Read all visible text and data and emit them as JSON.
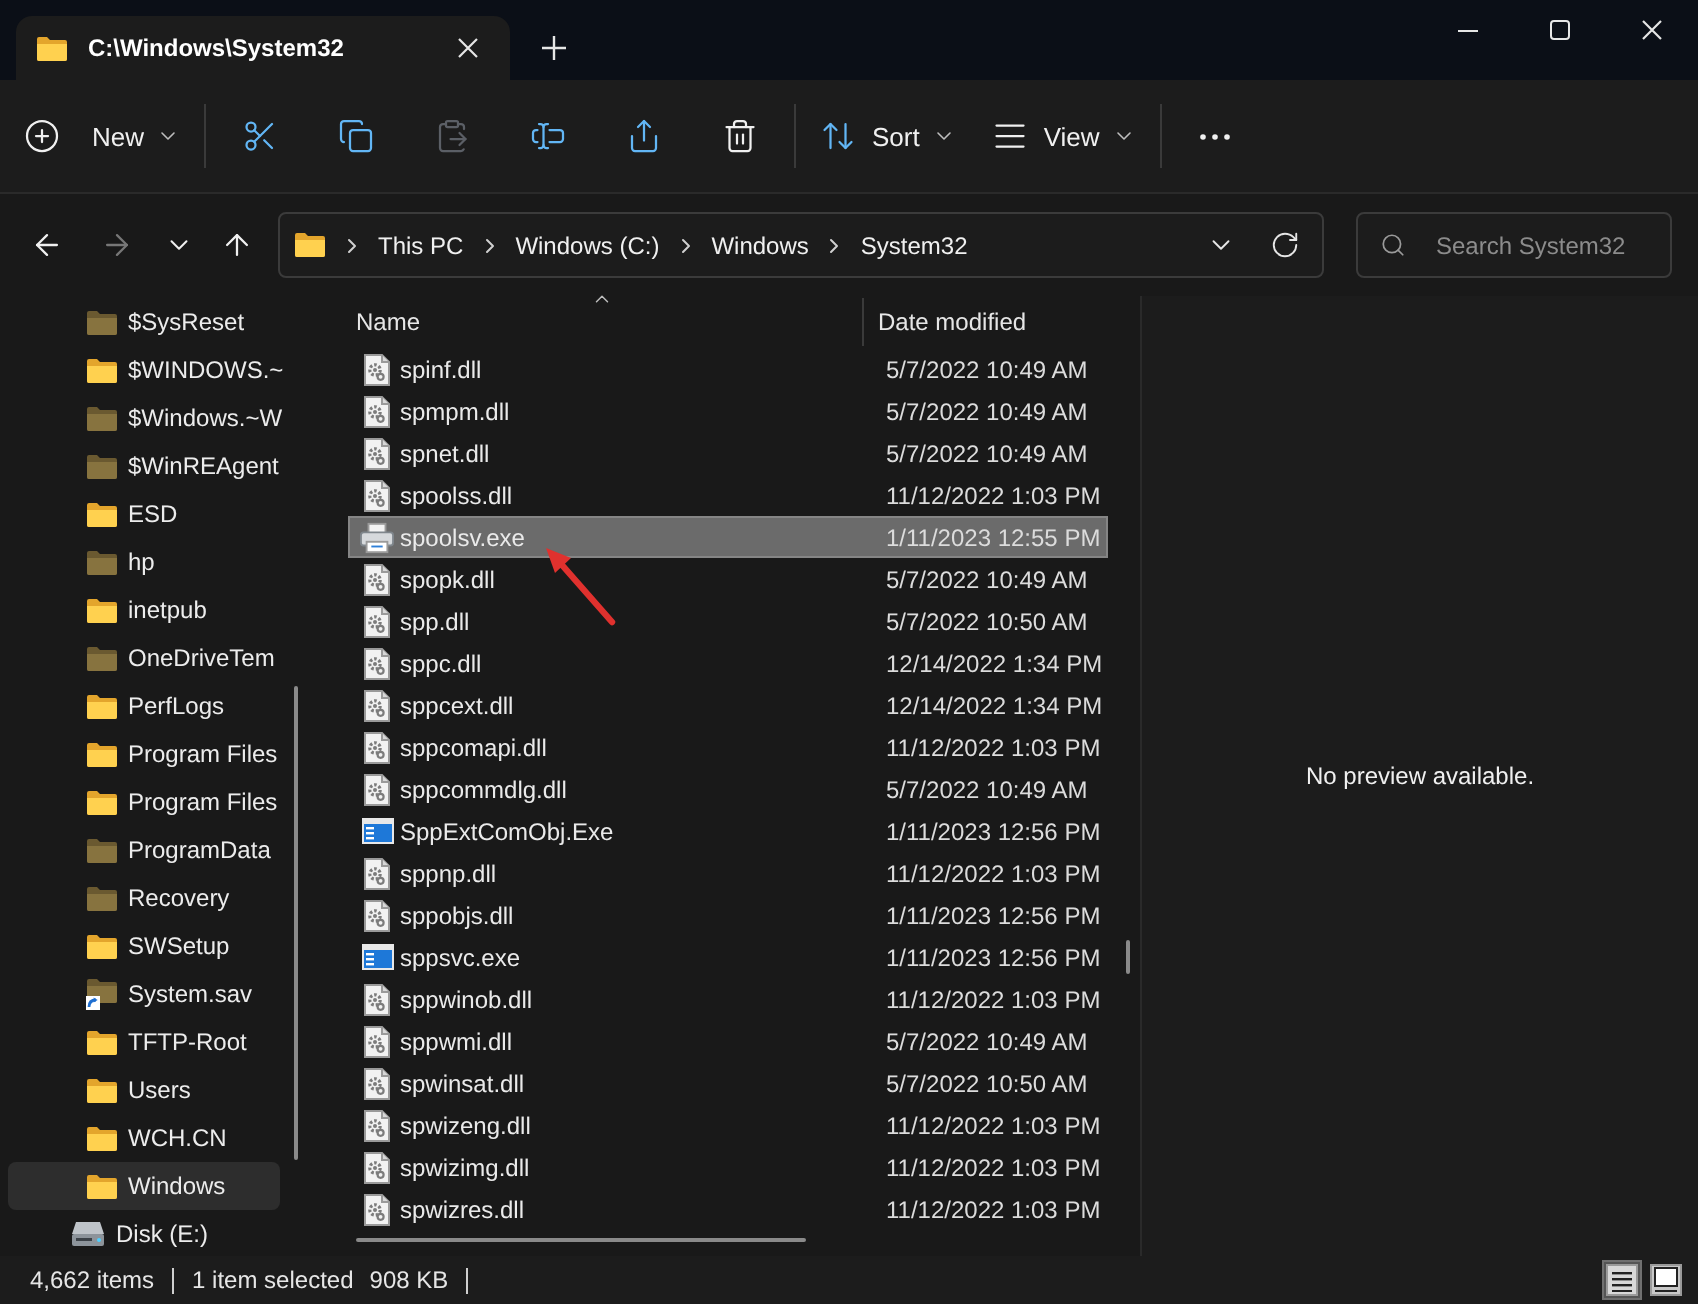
{
  "window": {
    "tab_title": "C:\\Windows\\System32"
  },
  "toolbar": [
    {
      "kind": "new",
      "label": "New",
      "disabled": false
    },
    {
      "kind": "cut",
      "disabled": false
    },
    {
      "kind": "copy",
      "disabled": false
    },
    {
      "kind": "paste",
      "disabled": true
    },
    {
      "kind": "rename",
      "disabled": false
    },
    {
      "kind": "share",
      "disabled": false
    },
    {
      "kind": "delete",
      "disabled": false
    },
    {
      "kind": "sort",
      "label": "Sort",
      "disabled": false
    },
    {
      "kind": "view",
      "label": "View",
      "disabled": false
    },
    {
      "kind": "more",
      "disabled": false
    }
  ],
  "navigation": [
    {
      "kind": "back",
      "disabled": false
    },
    {
      "kind": "forward",
      "disabled": true
    },
    {
      "kind": "recent",
      "disabled": false
    },
    {
      "kind": "up",
      "disabled": false
    }
  ],
  "address_bar": {
    "crumbs": [
      "This PC",
      "Windows (C:)",
      "Windows",
      "System32"
    ]
  },
  "search": {
    "placeholder": "Search System32"
  },
  "sidebar": {
    "items": [
      {
        "kind": "folder",
        "label": "$SysReset",
        "dimmed": true,
        "selected": false
      },
      {
        "kind": "folder",
        "label": "$WINDOWS.~",
        "dimmed": false,
        "selected": false
      },
      {
        "kind": "folder",
        "label": "$Windows.~W",
        "dimmed": true,
        "selected": false
      },
      {
        "kind": "folder",
        "label": "$WinREAgent",
        "dimmed": true,
        "selected": false
      },
      {
        "kind": "folder",
        "label": "ESD",
        "dimmed": false,
        "selected": false
      },
      {
        "kind": "folder",
        "label": "hp",
        "dimmed": true,
        "selected": false
      },
      {
        "kind": "folder",
        "label": "inetpub",
        "dimmed": false,
        "selected": false
      },
      {
        "kind": "folder",
        "label": "OneDriveTem",
        "dimmed": true,
        "selected": false
      },
      {
        "kind": "folder",
        "label": "PerfLogs",
        "dimmed": false,
        "selected": false
      },
      {
        "kind": "folder",
        "label": "Program Files",
        "dimmed": false,
        "selected": false
      },
      {
        "kind": "folder",
        "label": "Program Files",
        "dimmed": false,
        "selected": false
      },
      {
        "kind": "folder",
        "label": "ProgramData",
        "dimmed": true,
        "selected": false
      },
      {
        "kind": "folder",
        "label": "Recovery",
        "dimmed": true,
        "selected": false
      },
      {
        "kind": "folder",
        "label": "SWSetup",
        "dimmed": false,
        "selected": false
      },
      {
        "kind": "link",
        "label": "System.sav",
        "dimmed": true,
        "selected": false
      },
      {
        "kind": "folder",
        "label": "TFTP-Root",
        "dimmed": false,
        "selected": false
      },
      {
        "kind": "folder",
        "label": "Users",
        "dimmed": false,
        "selected": false
      },
      {
        "kind": "folder",
        "label": "WCH.CN",
        "dimmed": false,
        "selected": false
      },
      {
        "kind": "folder",
        "label": "Windows",
        "dimmed": false,
        "selected": true
      },
      {
        "kind": "drive",
        "label": "Disk (E:)",
        "dimmed": false,
        "selected": false
      }
    ]
  },
  "file_list": {
    "columns": [
      {
        "label": "Name",
        "sorted": true
      },
      {
        "label": "Date modified",
        "sorted": false
      }
    ],
    "rows": [
      {
        "kind": "dll",
        "name": "spinf.dll",
        "date": "5/7/2022 10:49 AM",
        "selected": false,
        "marked": false
      },
      {
        "kind": "dll",
        "name": "spmpm.dll",
        "date": "5/7/2022 10:49 AM",
        "selected": false,
        "marked": false
      },
      {
        "kind": "dll",
        "name": "spnet.dll",
        "date": "5/7/2022 10:49 AM",
        "selected": false,
        "marked": false
      },
      {
        "kind": "dll",
        "name": "spoolss.dll",
        "date": "11/12/2022 1:03 PM",
        "selected": false,
        "marked": false
      },
      {
        "kind": "printer",
        "name": "spoolsv.exe",
        "date": "1/11/2023 12:55 PM",
        "selected": true,
        "marked": true
      },
      {
        "kind": "dll",
        "name": "spopk.dll",
        "date": "5/7/2022 10:49 AM",
        "selected": false,
        "marked": false
      },
      {
        "kind": "dll",
        "name": "spp.dll",
        "date": "5/7/2022 10:50 AM",
        "selected": false,
        "marked": false
      },
      {
        "kind": "dll",
        "name": "sppc.dll",
        "date": "12/14/2022 1:34 PM",
        "selected": false,
        "marked": false
      },
      {
        "kind": "dll",
        "name": "sppcext.dll",
        "date": "12/14/2022 1:34 PM",
        "selected": false,
        "marked": false
      },
      {
        "kind": "dll",
        "name": "sppcomapi.dll",
        "date": "11/12/2022 1:03 PM",
        "selected": false,
        "marked": false
      },
      {
        "kind": "dll",
        "name": "sppcommdlg.dll",
        "date": "5/7/2022 10:49 AM",
        "selected": false,
        "marked": false
      },
      {
        "kind": "app",
        "name": "SppExtComObj.Exe",
        "date": "1/11/2023 12:56 PM",
        "selected": false,
        "marked": false
      },
      {
        "kind": "dll",
        "name": "sppnp.dll",
        "date": "11/12/2022 1:03 PM",
        "selected": false,
        "marked": false
      },
      {
        "kind": "dll",
        "name": "sppobjs.dll",
        "date": "1/11/2023 12:56 PM",
        "selected": false,
        "marked": false
      },
      {
        "kind": "app",
        "name": "sppsvc.exe",
        "date": "1/11/2023 12:56 PM",
        "selected": false,
        "marked": false
      },
      {
        "kind": "dll",
        "name": "sppwinob.dll",
        "date": "11/12/2022 1:03 PM",
        "selected": false,
        "marked": false
      },
      {
        "kind": "dll",
        "name": "sppwmi.dll",
        "date": "5/7/2022 10:49 AM",
        "selected": false,
        "marked": false
      },
      {
        "kind": "dll",
        "name": "spwinsat.dll",
        "date": "5/7/2022 10:50 AM",
        "selected": false,
        "marked": false
      },
      {
        "kind": "dll",
        "name": "spwizeng.dll",
        "date": "11/12/2022 1:03 PM",
        "selected": false,
        "marked": false
      },
      {
        "kind": "dll",
        "name": "spwizimg.dll",
        "date": "11/12/2022 1:03 PM",
        "selected": false,
        "marked": false
      },
      {
        "kind": "dll",
        "name": "spwizres.dll",
        "date": "11/12/2022 1:03 PM",
        "selected": false,
        "marked": false
      }
    ]
  },
  "preview": {
    "message": "No preview available."
  },
  "status_bar": {
    "item_count": "4,662 items",
    "selection": "1 item selected",
    "size": "908 KB",
    "views": [
      {
        "kind": "details",
        "selected": true
      },
      {
        "kind": "large_icons",
        "selected": false
      }
    ]
  }
}
